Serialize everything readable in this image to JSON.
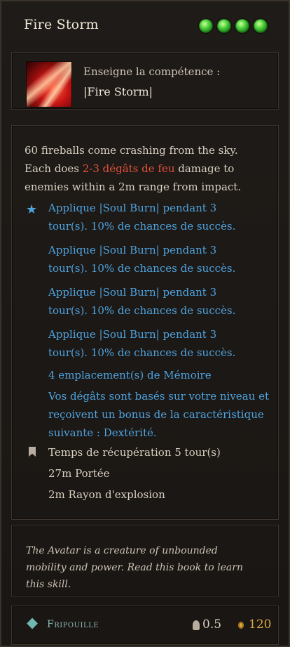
{
  "skill": {
    "title": "Fire Storm",
    "memory_orbs": 4
  },
  "teach": {
    "label": "Enseigne la compétence :",
    "skill_name": "|Fire Storm|"
  },
  "description": {
    "part1": "60 fireballs come crashing from the sky. Each does ",
    "damage": "2-3 dégâts de feu",
    "part2": " damage to enemies within a 2m range from impact."
  },
  "effects": [
    "Applique |Soul Burn| pendant 3 tour(s). 10% de chances de succès.",
    "Applique |Soul Burn| pendant 3 tour(s). 10% de chances de succès.",
    "Applique |Soul Burn| pendant 3 tour(s). 10% de chances de succès.",
    "Applique |Soul Burn| pendant 3 tour(s). 10% de chances de succès."
  ],
  "memory_slots": "4 emplacement(s) de Mémoire",
  "scaling": "Vos dégâts sont basés sur votre niveau et reçoivent un bonus de la caractéristique suivante : Dextérité.",
  "stats": {
    "cooldown": "Temps de récupération  5 tour(s)",
    "range": "27m  Portée",
    "radius": "2m  Rayon d'explosion"
  },
  "flavor": "The Avatar is a creature of unbounded mobility and power. Read this book to learn this skill.",
  "footer": {
    "class_name": "Fripouille",
    "weight": "0.5",
    "value": "120"
  },
  "colors": {
    "damage": "#e2523c",
    "effect": "#4ea3df",
    "gold": "#d7a93c",
    "class": "#8bb8b4"
  }
}
